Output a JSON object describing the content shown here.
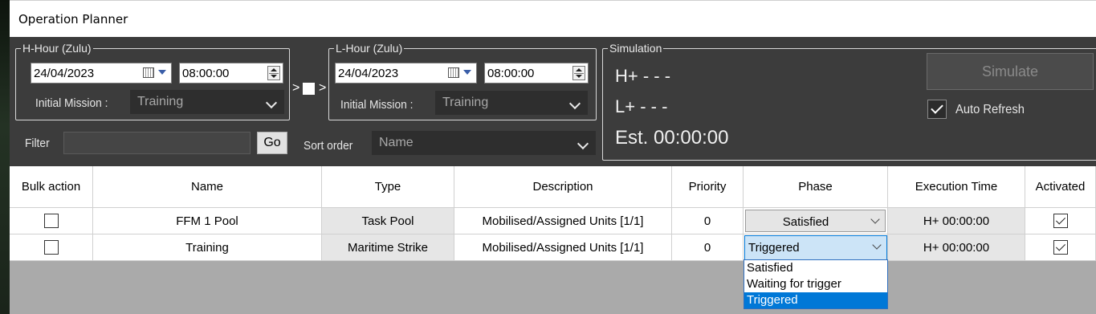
{
  "window": {
    "title": "Operation Planner"
  },
  "h_hour": {
    "legend": "H-Hour (Zulu)",
    "date": "24/04/2023",
    "time": "08:00:00",
    "initial_mission_label": "Initial Mission :",
    "initial_mission_value": "Training"
  },
  "l_hour": {
    "legend": "L-Hour (Zulu)",
    "date": "24/04/2023",
    "time": "08:00:00",
    "initial_mission_label": "Initial Mission :",
    "initial_mission_value": "Training"
  },
  "link": {
    "left": ">",
    "right": ">"
  },
  "filter": {
    "label": "Filter",
    "value": "",
    "go_label": "Go"
  },
  "sort": {
    "label": "Sort order",
    "value": "Name"
  },
  "simulation": {
    "legend": "Simulation",
    "h_plus": "H+ - - -",
    "l_plus": "L+ - - -",
    "est": "Est. 00:00:00",
    "simulate_label": "Simulate",
    "auto_refresh_label": "Auto Refresh",
    "auto_refresh_checked": true
  },
  "table": {
    "headers": {
      "bulk": "Bulk action",
      "name": "Name",
      "type": "Type",
      "description": "Description",
      "priority": "Priority",
      "phase": "Phase",
      "exec_time": "Execution Time",
      "activated": "Activated"
    },
    "rows": [
      {
        "bulk": false,
        "name": "FFM 1 Pool",
        "type": "Task Pool",
        "description": "Mobilised/Assigned Units [1/1]",
        "priority": "0",
        "phase": "Satisfied",
        "exec_time": "H+ 00:00:00",
        "activated": true
      },
      {
        "bulk": false,
        "name": "Training",
        "type": "Maritime Strike",
        "description": "Mobilised/Assigned Units [1/1]",
        "priority": "0",
        "phase": "Triggered",
        "exec_time": "H+ 00:00:00",
        "activated": true
      }
    ]
  },
  "phase_dropdown": {
    "options": [
      "Satisfied",
      "Waiting for trigger",
      "Triggered"
    ],
    "selected": "Triggered"
  },
  "colors": {
    "selection": "#0078d7",
    "panel": "#3c3c3c",
    "grid_bg": "#aaaaaa"
  }
}
